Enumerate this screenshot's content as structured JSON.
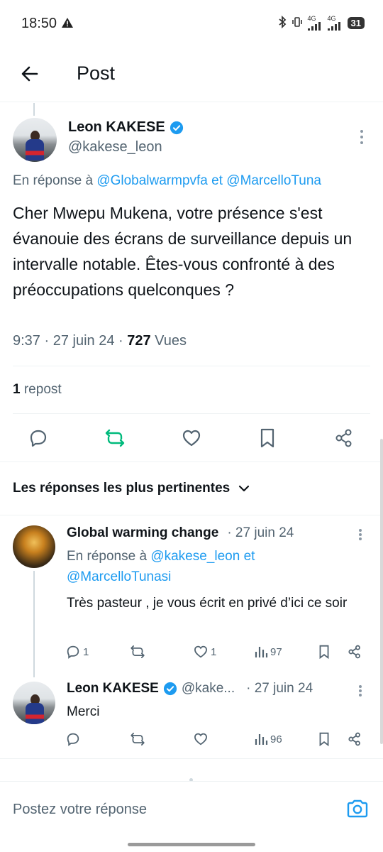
{
  "status_bar": {
    "time": "18:50",
    "battery": "31",
    "network_1": "4G",
    "network_2": "4G"
  },
  "header": {
    "title": "Post"
  },
  "post": {
    "author_name": "Leon KAKESE",
    "author_handle": "@kakese_leon",
    "reply_prefix": "En réponse à ",
    "reply_user_1": "@Globalwarmpvfa",
    "reply_joiner": " et ",
    "reply_user_2": "@MarcelloTuna",
    "text": "Cher Mwepu Mukena, votre présence s'est évanouie des écrans de surveillance depuis un intervalle notable. Êtes-vous confronté à des préoccupations quelconques ?",
    "time": "9:37",
    "date": "27 juin 24",
    "views_count": "727",
    "views_label": " Vues",
    "sep": " · ",
    "repost_count": "1",
    "repost_label": " repost"
  },
  "sort_label": "Les réponses les plus pertinentes",
  "replies": [
    {
      "name": "Global warming change",
      "date": "· 27 juin 24",
      "reply_prefix": "En réponse à ",
      "reply_user_1": "@kakese_leon",
      "reply_joiner": " et",
      "reply_user_2": "@MarcelloTunasi",
      "text": "Très pasteur , je vous écrit en privé d’ici ce soir",
      "comments": "1",
      "reposts": "",
      "likes": "1",
      "views": "97"
    },
    {
      "name": "Leon KAKESE",
      "handle": "@kake...",
      "date": "· 27 juin 24",
      "text": "Merci",
      "comments": "",
      "reposts": "",
      "likes": "",
      "views": "96"
    }
  ],
  "composer": {
    "placeholder": "Postez votre réponse"
  },
  "colors": {
    "accent": "#1d9bf0",
    "repost_active": "#00ba7c",
    "text": "#0f1419",
    "muted": "#536471"
  }
}
